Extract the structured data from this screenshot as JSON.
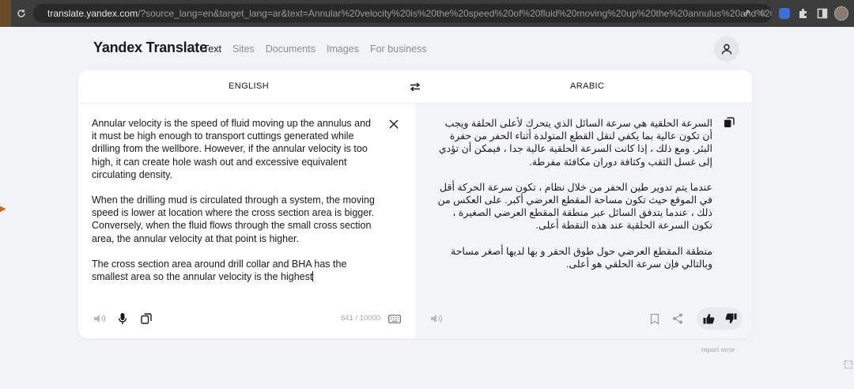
{
  "browser": {
    "url_host": "translate.yandex.com",
    "url_path": "/?source_lang=en&target_lang=ar&text=Annular%20velocity%20is%20the%20speed%20of%20fluid%20moving%20up%20the%20annulus%20and%20it%20must%..."
  },
  "header": {
    "logo": "Yandex Translate",
    "nav": [
      "Text",
      "Sites",
      "Documents",
      "Images",
      "For business"
    ],
    "active_nav": "Text"
  },
  "translator": {
    "source_lang": "ENGLISH",
    "target_lang": "ARABIC",
    "source_paragraphs": [
      "Annular velocity is the speed of fluid moving up the annulus and it must be high enough to transport cuttings generated while drilling from the wellbore. However, if the annular velocity is too high, it can create hole wash out and excessive equivalent circulating density.",
      "When the drilling mud is circulated through a system, the moving speed is lower at location where the cross section area is bigger. Conversely, when the fluid flows through the small cross section area, the annular velocity at that point is higher.",
      "The cross section area around drill collar and BHA has the smallest area so the annular velocity is the highest"
    ],
    "target_paragraphs": [
      "السرعة الحلقية هي سرعة السائل الذي يتحرك لأعلى الحلقة ويجب أن تكون عالية بما يكفي لنقل القطع المتولدة أثناء الحفر من حفرة البئر. ومع ذلك ، إذا كانت السرعة الحلقية عالية جدا ، فيمكن أن تؤدي إلى غسل الثقب وكثافة دوران مكافئة مفرطة.",
      "عندما يتم تدوير طين الحفر من خلال نظام ، تكون سرعة الحركة أقل في الموقع حيث تكون مساحة المقطع العرضي أكبر. على العكس من ذلك ، عندما يتدفق السائل عبر منطقة المقطع العرضي الصغيرة ، تكون السرعة الحلقية عند هذه النقطة أعلى.",
      "منطقة المقطع العرضي حول طوق الحفر و بها لديها أصغر مساحة وبالتالي فإن سرعة الحلقي هو أعلى."
    ],
    "char_counter": "641 / 10000",
    "report_error": "report error"
  },
  "icons": {
    "clear": "close-icon",
    "swap": "swap-arrows-icon",
    "speaker": "speaker-icon",
    "mic": "microphone-icon",
    "copy": "copy-icon",
    "keyboard": "keyboard-icon",
    "bookmark": "bookmark-icon",
    "share": "share-icon",
    "like": "thumbs-up-icon",
    "dislike": "thumbs-down-icon",
    "user": "user-icon"
  }
}
